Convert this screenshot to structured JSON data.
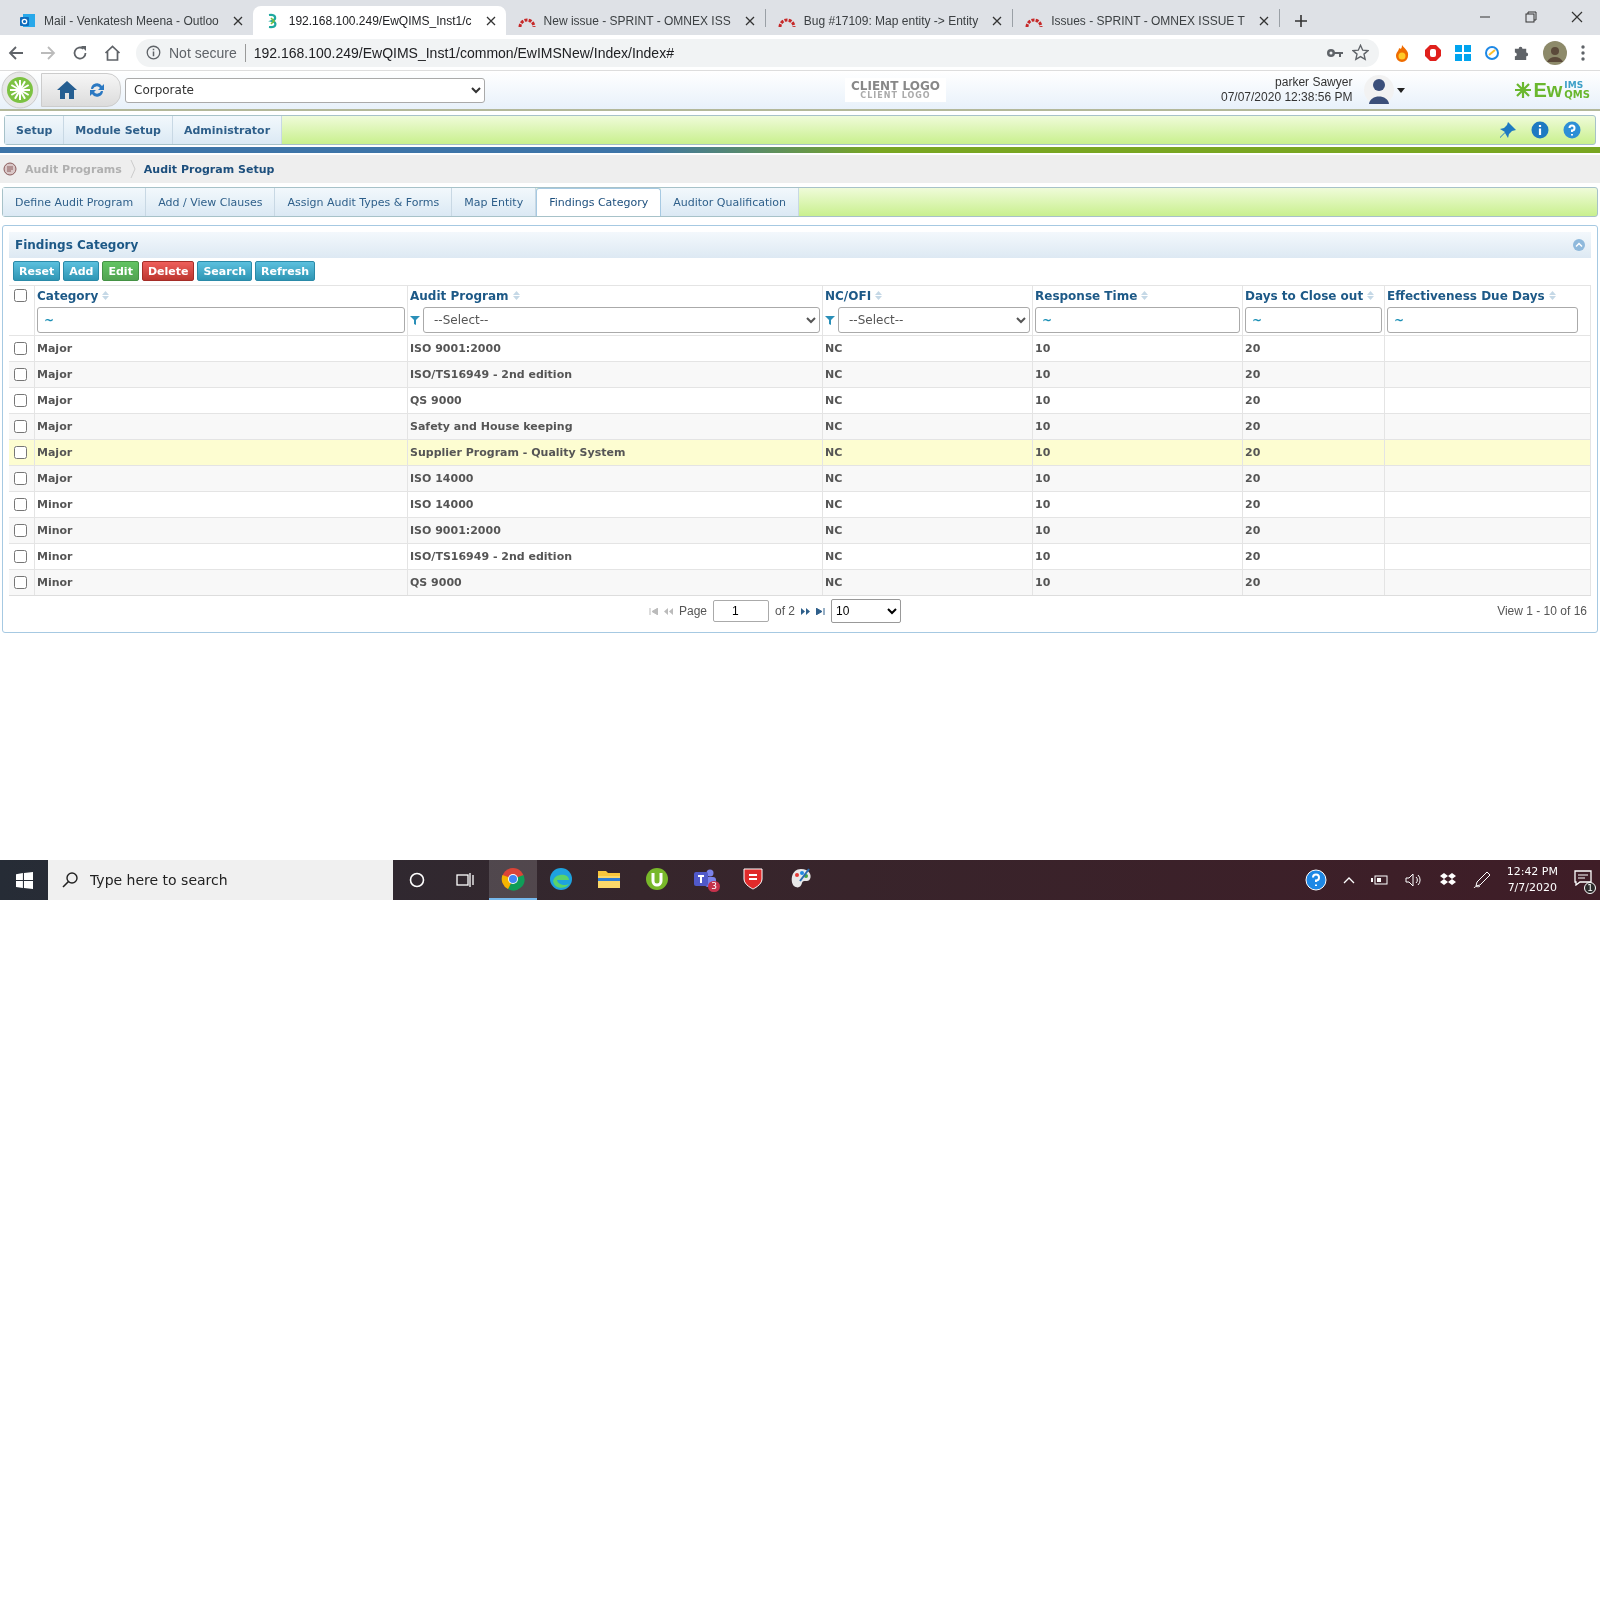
{
  "browser": {
    "tabs": [
      {
        "kind": "mail",
        "title": "Mail - Venkatesh Meena - Outloo",
        "selected": false
      },
      {
        "kind": "app",
        "title": "192.168.100.249/EwQIMS_Inst1/c",
        "selected": true
      },
      {
        "kind": "tracker",
        "title": "New issue - SPRINT - OMNEX ISS",
        "selected": false
      },
      {
        "kind": "tracker",
        "title": "Bug #17109: Map entity -> Entity",
        "selected": false
      },
      {
        "kind": "tracker",
        "title": "Issues - SPRINT - OMNEX ISSUE T",
        "selected": false
      }
    ],
    "security": "Not secure",
    "url": "192.168.100.249/EwQIMS_Inst1/common/EwIMSNew/Index/Index#"
  },
  "app": {
    "site": "Corporate",
    "client_logo": "CLIENT LOGO",
    "client_logo_sub": "CLIENT LOGO",
    "user": "parker Sawyer",
    "datetime": "07/07/2020 12:38:56 PM",
    "brand": "Ew",
    "brand_sup": "IMS",
    "brand_sub": "QMS"
  },
  "menu": [
    "Setup",
    "Module Setup",
    "Administrator"
  ],
  "breadcrumb": [
    "Audit Programs",
    "Audit Program Setup"
  ],
  "tabs": [
    {
      "label": "Define Audit Program",
      "selected": false
    },
    {
      "label": "Add / View Clauses",
      "selected": false
    },
    {
      "label": "Assign Audit Types & Forms",
      "selected": false
    },
    {
      "label": "Map Entity",
      "selected": false
    },
    {
      "label": "Findings Category",
      "selected": true
    },
    {
      "label": "Auditor Qualification",
      "selected": false
    }
  ],
  "panel": {
    "title": "Findings Category",
    "buttons": [
      {
        "label": "Reset",
        "kind": "info"
      },
      {
        "label": "Add",
        "kind": "info"
      },
      {
        "label": "Edit",
        "kind": "success"
      },
      {
        "label": "Delete",
        "kind": "danger"
      },
      {
        "label": "Search",
        "kind": "info"
      },
      {
        "label": "Refresh",
        "kind": "info"
      }
    ],
    "columns": [
      {
        "label": "Category",
        "kind": "text",
        "value": "~"
      },
      {
        "label": "Audit Program",
        "kind": "select",
        "value": "--Select--"
      },
      {
        "label": "NC/OFI",
        "kind": "select",
        "value": "--Select--"
      },
      {
        "label": "Response Time",
        "kind": "text",
        "value": "~"
      },
      {
        "label": "Days to Close out",
        "kind": "text",
        "value": "~"
      },
      {
        "label": "Effectiveness Due Days",
        "kind": "text",
        "value": "~"
      }
    ],
    "select_all_checked": false,
    "rows": [
      {
        "checked": false,
        "highlighted": false,
        "cells": [
          "Major",
          "ISO 9001:2000",
          "NC",
          "10",
          "20"
        ]
      },
      {
        "checked": false,
        "highlighted": false,
        "cells": [
          "Major",
          "ISO/TS16949 - 2nd edition",
          "NC",
          "10",
          "20"
        ]
      },
      {
        "checked": false,
        "highlighted": false,
        "cells": [
          "Major",
          "QS 9000",
          "NC",
          "10",
          "20"
        ]
      },
      {
        "checked": false,
        "highlighted": false,
        "cells": [
          "Major",
          "Safety and House keeping",
          "NC",
          "10",
          "20"
        ]
      },
      {
        "checked": false,
        "highlighted": true,
        "cells": [
          "Major",
          "Supplier Program - Quality System",
          "NC",
          "10",
          "20"
        ]
      },
      {
        "checked": false,
        "highlighted": false,
        "cells": [
          "Major",
          "ISO 14000",
          "NC",
          "10",
          "20"
        ]
      },
      {
        "checked": false,
        "highlighted": false,
        "cells": [
          "Minor",
          "ISO 14000",
          "NC",
          "10",
          "20"
        ]
      },
      {
        "checked": false,
        "highlighted": false,
        "cells": [
          "Minor",
          "ISO 9001:2000",
          "NC",
          "10",
          "20"
        ]
      },
      {
        "checked": false,
        "highlighted": false,
        "cells": [
          "Minor",
          "ISO/TS16949 - 2nd edition",
          "NC",
          "10",
          "20"
        ]
      },
      {
        "checked": false,
        "highlighted": false,
        "cells": [
          "Minor",
          "QS 9000",
          "NC",
          "10",
          "20"
        ]
      }
    ],
    "pager": {
      "page_label": "Page",
      "page": "1",
      "of": "of 2",
      "page_size": "10",
      "view": "View 1 - 10 of 16"
    }
  },
  "taskbar": {
    "search_placeholder": "Type here to search",
    "apps": [
      {
        "kind": "browser",
        "active": true
      },
      {
        "kind": "edge",
        "active": false
      },
      {
        "kind": "folder",
        "active": false
      },
      {
        "kind": "torrent",
        "active": false
      },
      {
        "kind": "teams",
        "active": false,
        "badge": "3"
      },
      {
        "kind": "shield",
        "active": false
      },
      {
        "kind": "paint",
        "active": false
      }
    ],
    "time": "12:42 PM",
    "date": "7/7/2020",
    "notifications": "1"
  }
}
